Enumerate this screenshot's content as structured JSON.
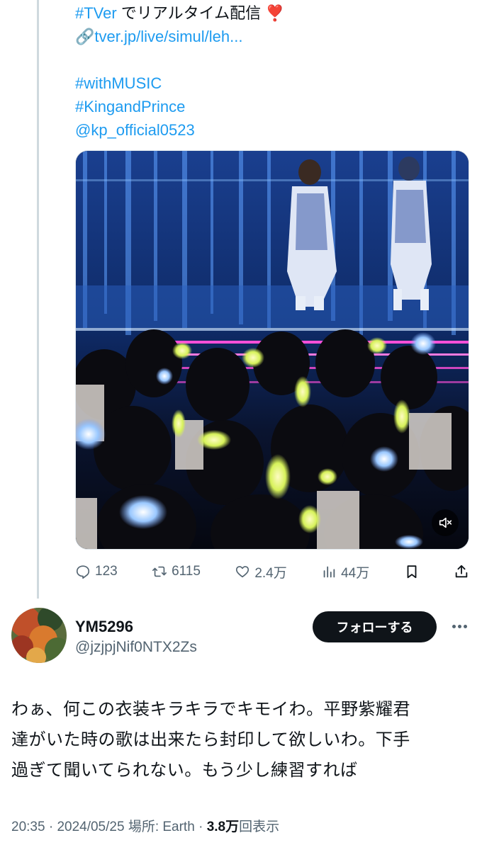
{
  "parent_tweet": {
    "text_lines": [
      {
        "hashtag": "#TVer",
        "rest": " でリアルタイム配信 ❣️"
      },
      {
        "link_icon": "🔗",
        "link": "tver.jp/live/simul/leh..."
      }
    ],
    "tags": [
      "#withMUSIC",
      "#KingandPrince",
      "@kp_official0523"
    ],
    "media": {
      "type": "video",
      "description_icon": "mute-icon"
    },
    "actions": {
      "replies": "123",
      "retweets": "6115",
      "likes": "2.4万",
      "views": "44万"
    }
  },
  "reply": {
    "display_name": "YM5296",
    "handle": "@jzjpjNif0NTX2Zs",
    "follow_label": "フォローする",
    "body_lines": [
      "わぁ、何この衣装キラキラでキモイわ。平野紫耀君",
      "達がいた時の歌は出来たら封印して欲しいわ。下手",
      "過ぎて聞いてられない。もう少し練習すれば"
    ],
    "meta": {
      "time": "20:35",
      "date": "2024/05/25",
      "location_label": "場所: Earth",
      "views_count": "3.8万",
      "views_label": "回表示"
    }
  },
  "colors": {
    "link": "#1d9bf0",
    "text": "#0f1419",
    "secondary": "#536471",
    "follow_bg": "#0f1419"
  }
}
